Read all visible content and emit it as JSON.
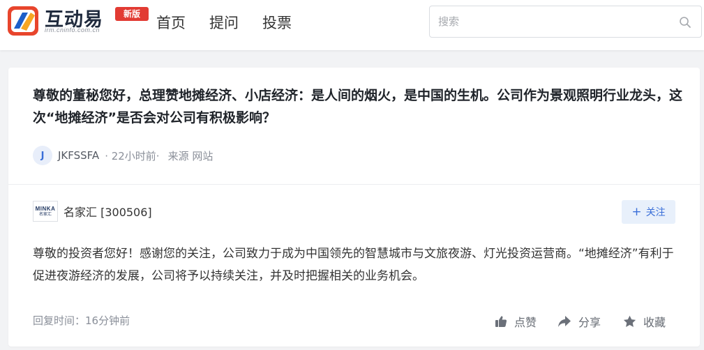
{
  "header": {
    "logo_text": "互动易",
    "logo_sub": "irm.cninfo.com.cn",
    "logo_badge": "新版",
    "nav": [
      "首页",
      "提问",
      "投票"
    ],
    "search_placeholder": "搜索"
  },
  "question": {
    "text": "尊敬的董秘您好，总理赞地摊经济、小店经济：是人间的烟火，是中国的生机。公司作为景观照明行业龙头，这次“地摊经济”是否会对公司有积极影响？",
    "avatar_letter": "J",
    "user": "JKFSSFA",
    "time": "· 22小时前·",
    "source": "来源 网站"
  },
  "answer": {
    "company_logo_top": "MINKA",
    "company_logo_bottom": "名家汇",
    "company_name": "名家汇 [300506]",
    "follow_label": "关注",
    "text": "尊敬的投资者您好！感谢您的关注，公司致力于成为中国领先的智慧城市与文旅夜游、灯光投资运营商。“地摊经济”有利于促进夜游经济的发展，公司将予以持续关注，并及时把握相关的业务机会。",
    "reply_time": "回复时间：16分钟前",
    "actions": {
      "like": "点赞",
      "share": "分享",
      "collect": "收藏"
    }
  },
  "colors": {
    "accent": "#3a6fd8",
    "badge": "#e23b33",
    "page_bg": "#f2f3f5"
  }
}
